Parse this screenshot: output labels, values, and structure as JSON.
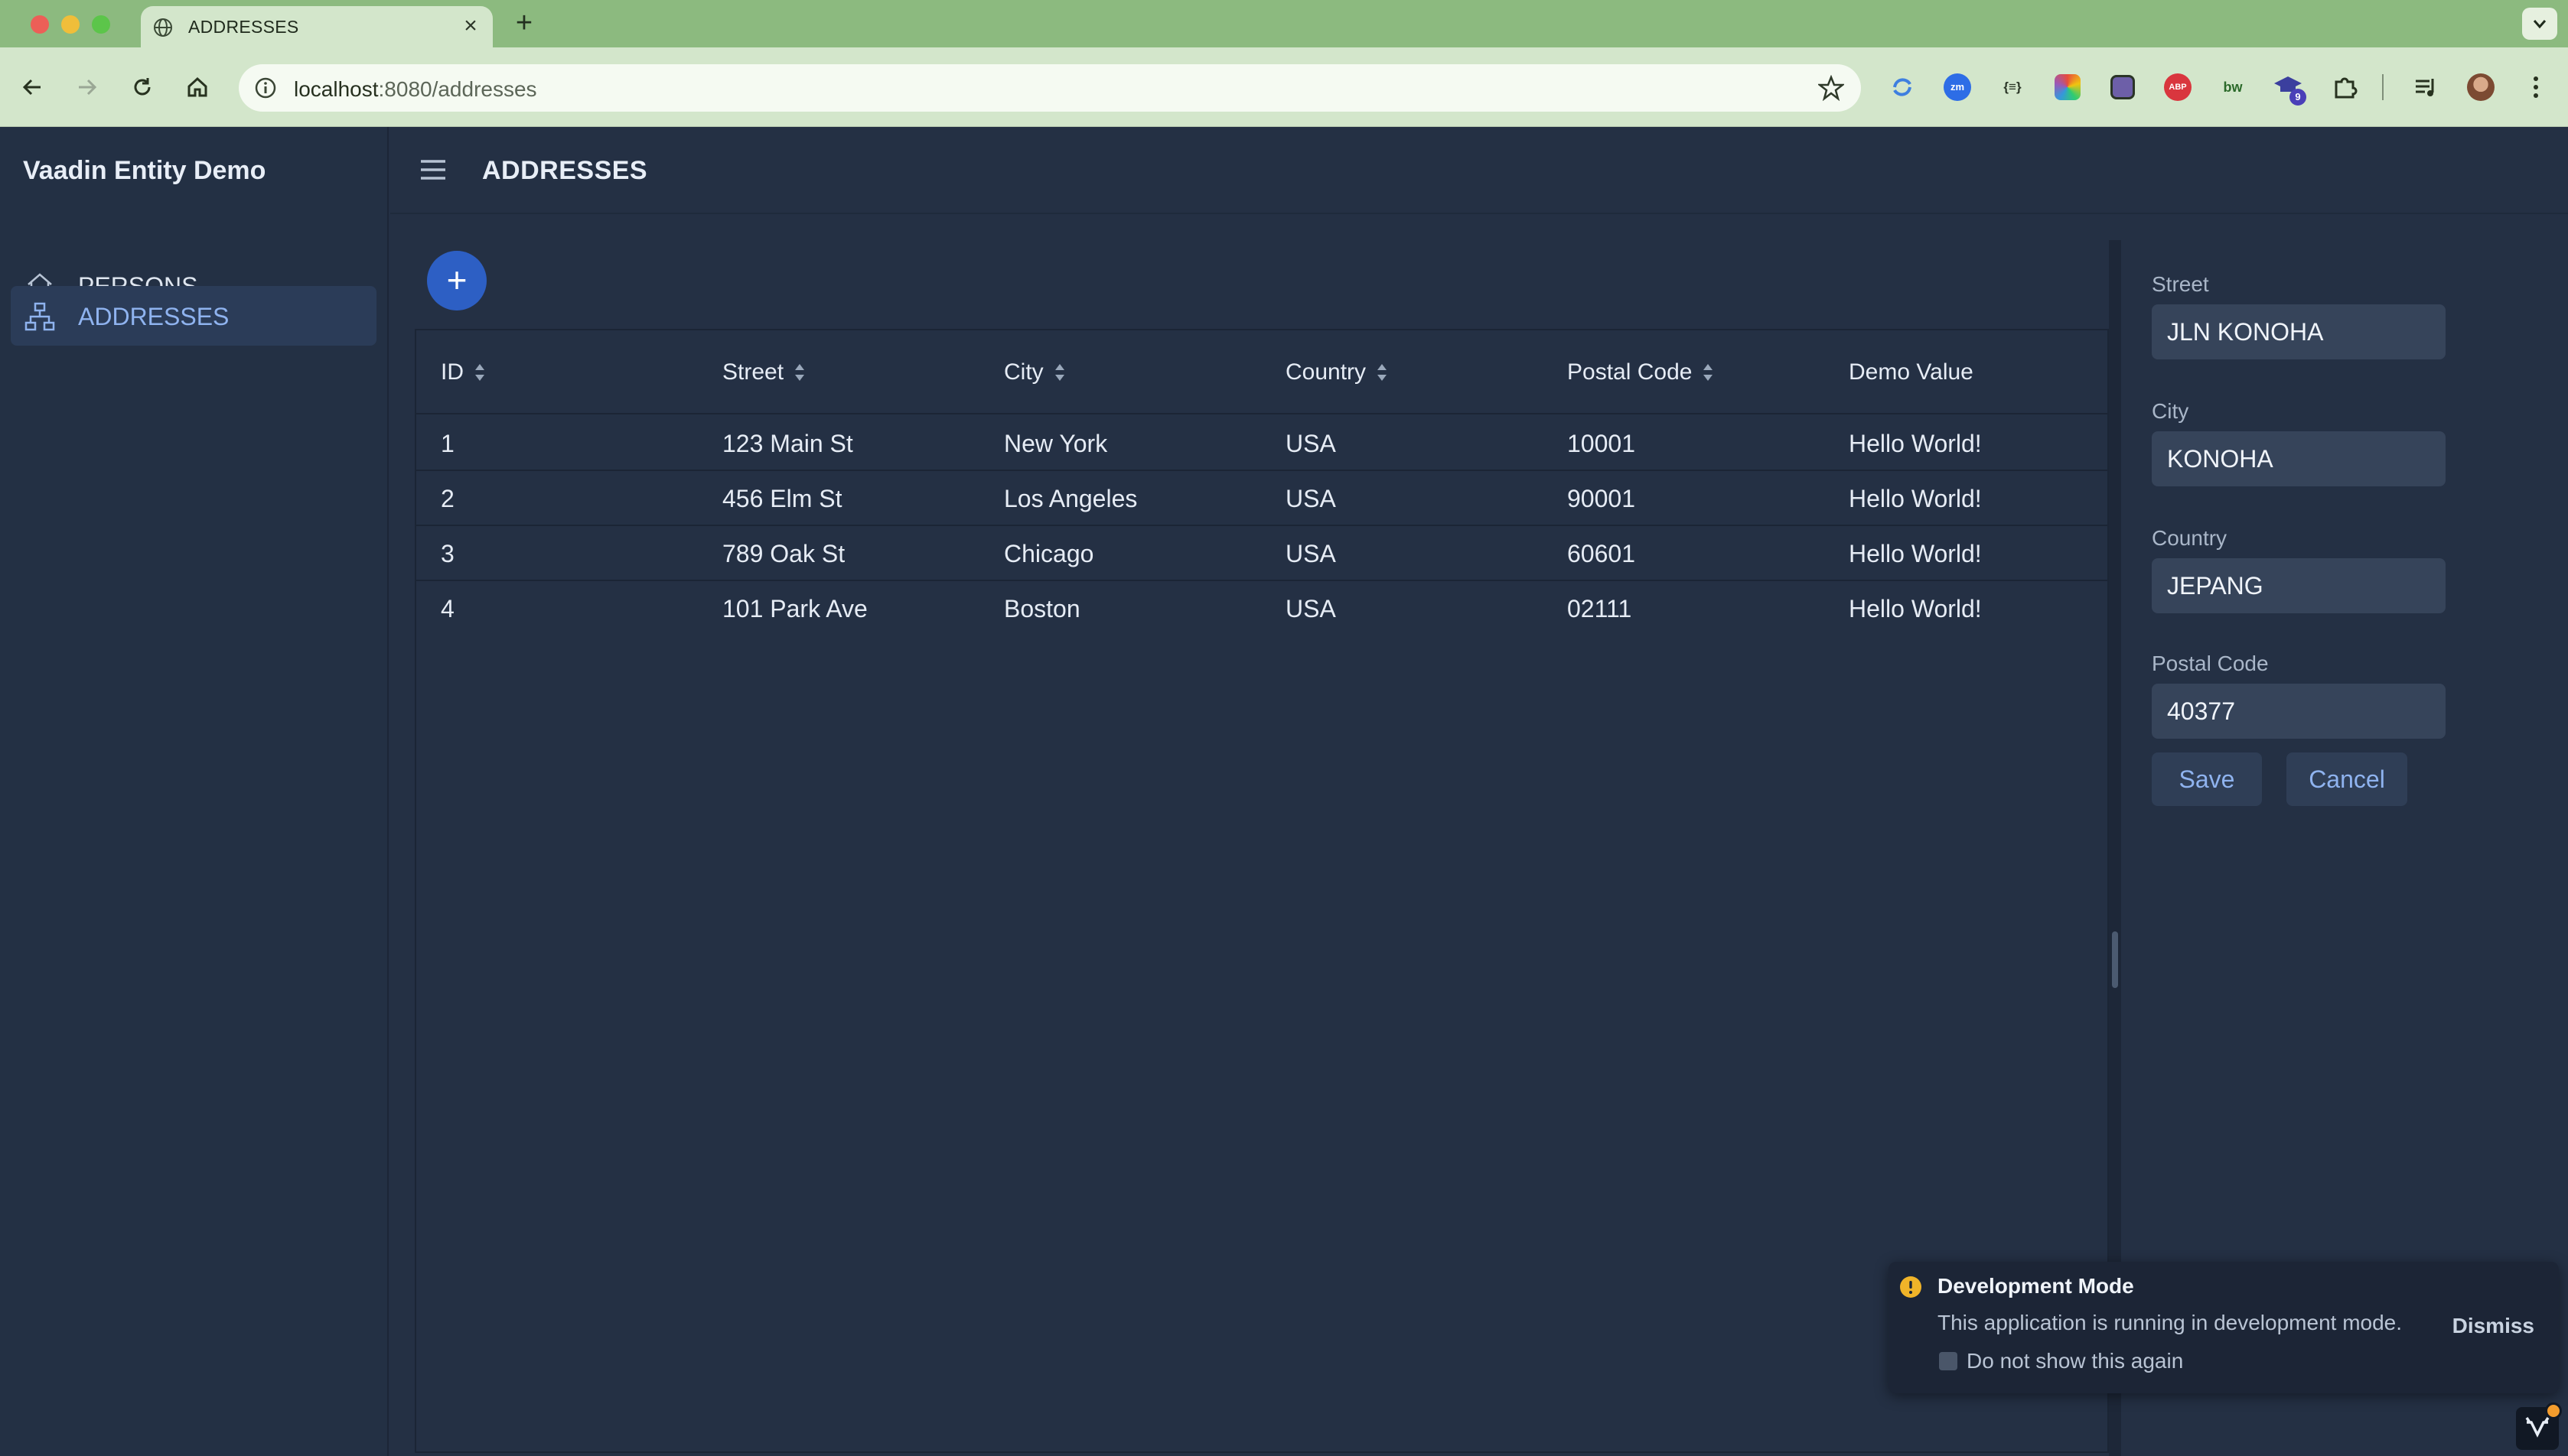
{
  "browser": {
    "tab_title": "ADDRESSES",
    "url_host": "localhost",
    "url_rest": ":8080/addresses",
    "extension_badge": "9",
    "extensions": [
      "zm",
      "{≡}",
      "ABP",
      "bw"
    ]
  },
  "app": {
    "brand": "Vaadin Entity Demo",
    "page_title": "ADDRESSES",
    "nav": [
      {
        "label": "PERSONS",
        "icon": "home-icon",
        "active": false
      },
      {
        "label": "ADDRESSES",
        "icon": "sitemap-icon",
        "active": true
      }
    ]
  },
  "grid": {
    "columns": [
      "ID",
      "Street",
      "City",
      "Country",
      "Postal Code",
      "Demo Value"
    ],
    "rows": [
      {
        "id": "1",
        "street": "123 Main St",
        "city": "New York",
        "country": "USA",
        "postal": "10001",
        "demo": "Hello World!"
      },
      {
        "id": "2",
        "street": "456 Elm St",
        "city": "Los Angeles",
        "country": "USA",
        "postal": "90001",
        "demo": "Hello World!"
      },
      {
        "id": "3",
        "street": "789 Oak St",
        "city": "Chicago",
        "country": "USA",
        "postal": "60601",
        "demo": "Hello World!"
      },
      {
        "id": "4",
        "street": "101 Park Ave",
        "city": "Boston",
        "country": "USA",
        "postal": "02111",
        "demo": "Hello World!"
      }
    ]
  },
  "form": {
    "street_label": "Street",
    "street_value": "JLN KONOHA",
    "city_label": "City",
    "city_value": "KONOHA",
    "country_label": "Country",
    "country_value": "JEPANG",
    "postal_label": "Postal Code",
    "postal_value": "40377",
    "save_label": "Save",
    "cancel_label": "Cancel"
  },
  "notification": {
    "title": "Development Mode",
    "message": "This application is running in development mode.",
    "checkbox_label": "Do not show this again",
    "dismiss_label": "Dismiss"
  },
  "colors": {
    "accent": "#2d5fc4",
    "background": "#243044",
    "chrome": "#d3e6cb"
  }
}
